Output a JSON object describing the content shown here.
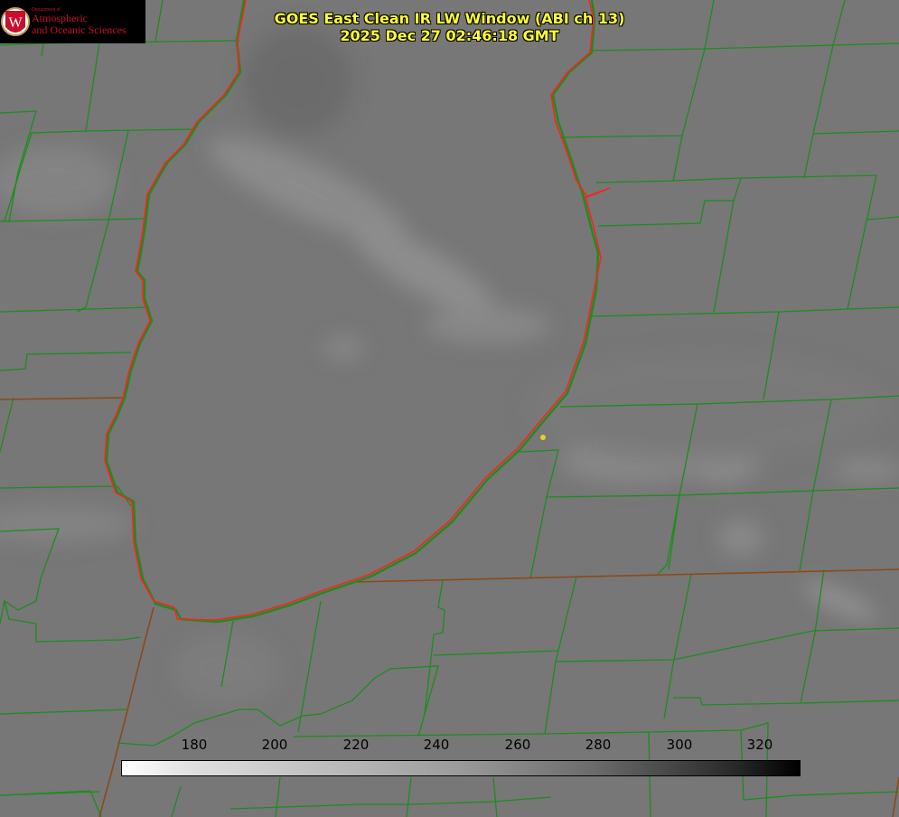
{
  "title": {
    "line1": "GOES East Clean IR LW Window (ABI ch 13)",
    "line2": "2025 Dec 27 02:46:18 GMT"
  },
  "logo": {
    "department": "Department of",
    "line1": "Atmospheric",
    "line2": "and Oceanic Sciences",
    "emblem": "W"
  },
  "colorbar": {
    "ticks": [
      "180",
      "200",
      "220",
      "240",
      "260",
      "280",
      "300",
      "320"
    ],
    "tick_values": [
      180,
      200,
      220,
      240,
      260,
      280,
      300,
      320
    ],
    "range": [
      162,
      330
    ],
    "colormap": "white-to-black grayscale"
  },
  "colors": {
    "title": "#ffff33",
    "county_lines": "#1e8c1e",
    "lake_outline": "#ff2020",
    "state_line": "#8a4a1a",
    "marker": "#e8d020"
  }
}
